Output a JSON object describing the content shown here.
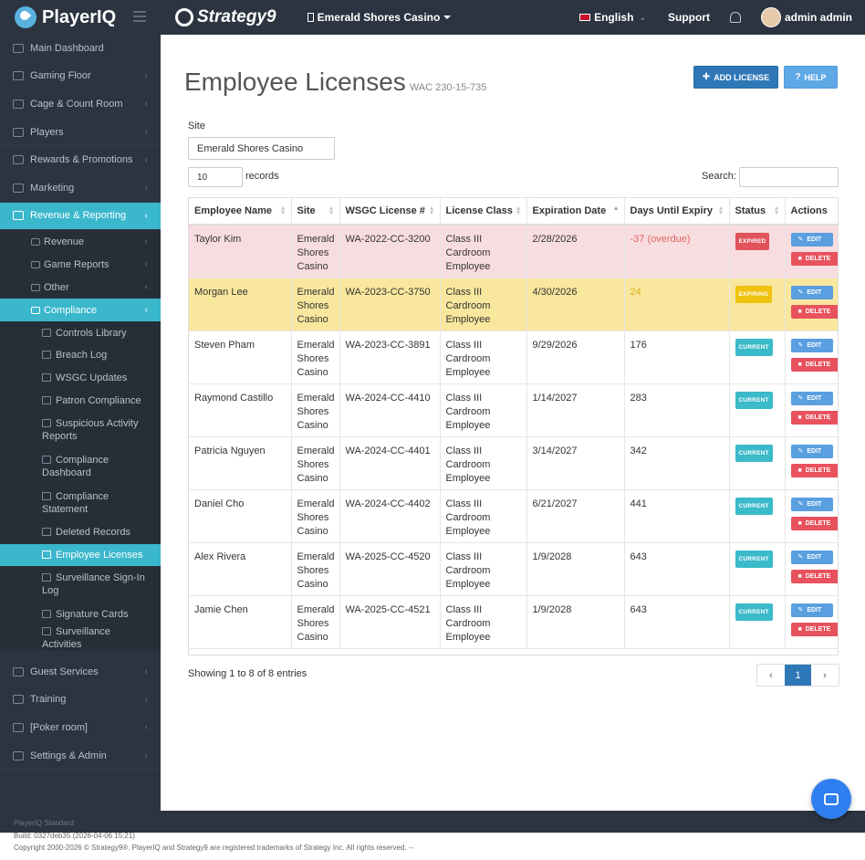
{
  "brand": {
    "name": "PlayerIQ",
    "partner": "Strategy9"
  },
  "topbar": {
    "site": "Emerald Shores Casino",
    "language": "English",
    "support": "Support",
    "user": "admin admin"
  },
  "sidebar": {
    "items": [
      {
        "label": "Main Dashboard"
      },
      {
        "label": "Gaming Floor"
      },
      {
        "label": "Cage & Count Room"
      },
      {
        "label": "Players"
      },
      {
        "label": "Rewards & Promotions"
      },
      {
        "label": "Marketing"
      },
      {
        "label": "Revenue & Reporting"
      }
    ],
    "sub": [
      {
        "label": "Revenue"
      },
      {
        "label": "Game Reports"
      },
      {
        "label": "Other"
      },
      {
        "label": "Compliance"
      }
    ],
    "compliance": [
      {
        "label": "Controls Library"
      },
      {
        "label": "Breach Log"
      },
      {
        "label": "WSGC Updates"
      },
      {
        "label": "Patron Compliance"
      },
      {
        "label": "Suspicious Activity Reports"
      },
      {
        "label": "Compliance Dashboard"
      },
      {
        "label": "Compliance Statement"
      },
      {
        "label": "Deleted Records"
      },
      {
        "label": "Employee Licenses"
      },
      {
        "label": "Surveillance Sign-In Log"
      },
      {
        "label": "Signature Cards"
      },
      {
        "label": "Surveillance Activities"
      }
    ],
    "bottom": [
      {
        "label": "Guest Services"
      },
      {
        "label": "Training"
      },
      {
        "label": "[Poker room]"
      },
      {
        "label": "Settings & Admin"
      }
    ],
    "edition": "PlayerIQ Standard"
  },
  "footer": {
    "build": "Build: 0327deb35 (2026-04-06 15:21)",
    "copyright": "Copyright 2000-2026 © Strategy9®. PlayerIQ and Strategy9 are registered trademarks of Strategy Inc. All rights reserved. --"
  },
  "page": {
    "title": "Employee Licenses",
    "subtitle": "WAC 230-15-735",
    "add_label": "ADD LICENSE",
    "help_label": "HELP",
    "site_label": "Site",
    "site_value": "Emerald Shores Casino",
    "page_length": "10",
    "records_label": "records",
    "search_label": "Search:",
    "search_value": ""
  },
  "table": {
    "columns": [
      "Employee Name",
      "Site",
      "WSGC License #",
      "License Class",
      "Expiration Date",
      "Days Until Expiry",
      "Status",
      "Actions"
    ],
    "edit_label": "EDIT",
    "delete_label": "DELETE",
    "rows": [
      {
        "name": "Taylor Kim",
        "site": "Emerald Shores Casino",
        "license": "WA-2022-CC-3200",
        "class": "Class III Cardroom Employee",
        "expires": "2/28/2026",
        "days": "-37 (overdue)",
        "status": "EXPIRED"
      },
      {
        "name": "Morgan Lee",
        "site": "Emerald Shores Casino",
        "license": "WA-2023-CC-3750",
        "class": "Class III Cardroom Employee",
        "expires": "4/30/2026",
        "days": "24",
        "status": "EXPIRING"
      },
      {
        "name": "Steven Pham",
        "site": "Emerald Shores Casino",
        "license": "WA-2023-CC-3891",
        "class": "Class III Cardroom Employee",
        "expires": "9/29/2026",
        "days": "176",
        "status": "CURRENT"
      },
      {
        "name": "Raymond Castillo",
        "site": "Emerald Shores Casino",
        "license": "WA-2024-CC-4410",
        "class": "Class III Cardroom Employee",
        "expires": "1/14/2027",
        "days": "283",
        "status": "CURRENT"
      },
      {
        "name": "Patricia Nguyen",
        "site": "Emerald Shores Casino",
        "license": "WA-2024-CC-4401",
        "class": "Class III Cardroom Employee",
        "expires": "3/14/2027",
        "days": "342",
        "status": "CURRENT"
      },
      {
        "name": "Daniel Cho",
        "site": "Emerald Shores Casino",
        "license": "WA-2024-CC-4402",
        "class": "Class III Cardroom Employee",
        "expires": "6/21/2027",
        "days": "441",
        "status": "CURRENT"
      },
      {
        "name": "Alex Rivera",
        "site": "Emerald Shores Casino",
        "license": "WA-2025-CC-4520",
        "class": "Class III Cardroom Employee",
        "expires": "1/9/2028",
        "days": "643",
        "status": "CURRENT"
      },
      {
        "name": "Jamie Chen",
        "site": "Emerald Shores Casino",
        "license": "WA-2025-CC-4521",
        "class": "Class III Cardroom Employee",
        "expires": "1/9/2028",
        "days": "643",
        "status": "CURRENT"
      }
    ]
  },
  "pagination": {
    "info": "Showing 1 to 8 of 8 entries",
    "prev": "‹",
    "current": "1",
    "next": "›"
  },
  "colors": {
    "accent": "#3bb7cc",
    "primary": "#2f78b7",
    "sidebar": "#2b3440",
    "expired_row": "#f8dde0",
    "expiring_row": "#f8e79d"
  }
}
